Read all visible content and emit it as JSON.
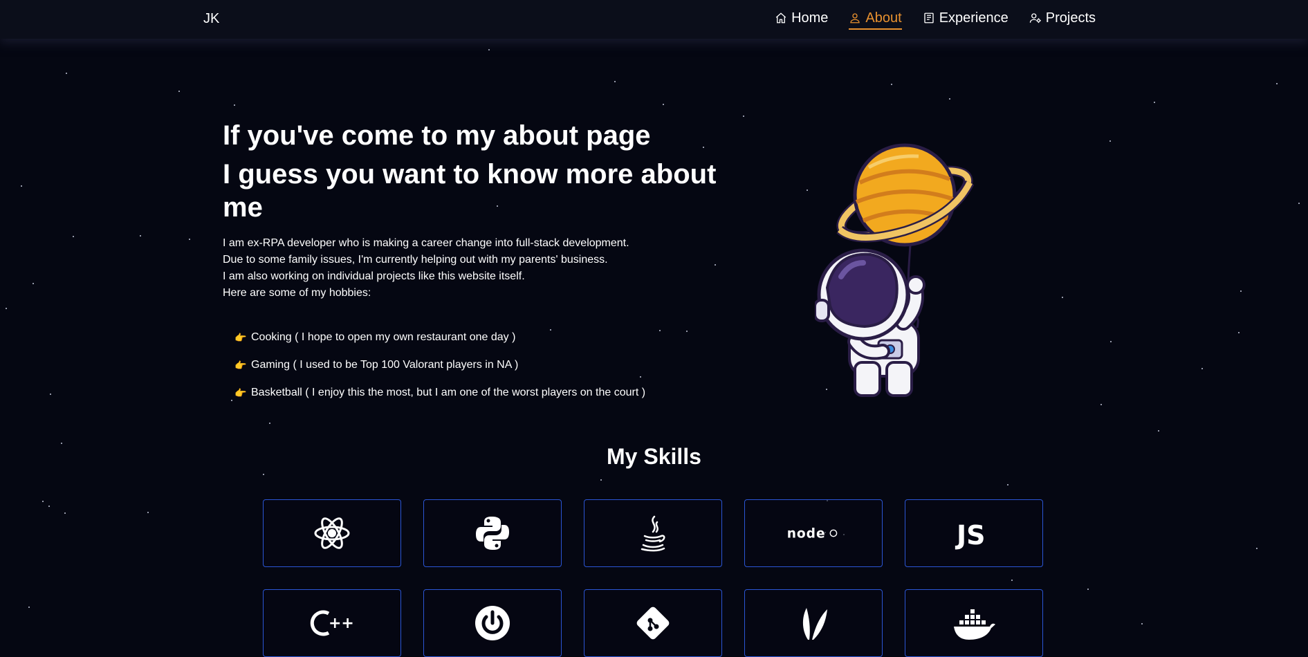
{
  "nav": {
    "brand": "JK",
    "items": [
      {
        "label": "Home",
        "icon": "home-icon"
      },
      {
        "label": "About",
        "icon": "user-icon",
        "active": true
      },
      {
        "label": "Experience",
        "icon": "document-icon"
      },
      {
        "label": "Projects",
        "icon": "user-gear-icon"
      }
    ]
  },
  "hero": {
    "title_line1": "If you've come to my about page",
    "title_line2": "I guess you want to know more about me",
    "paragraph": [
      "I am ex-RPA developer who is making a career change into full-stack development.",
      "Due to some family issues, I'm currently helping out with my parents' business.",
      "I am also working on individual projects like this website itself.",
      "Here are some of my hobbies:"
    ],
    "hobby_emoji": "👉",
    "hobbies": [
      "Cooking ( I hope to open my own restaurant one day )",
      "Gaming ( I used to be Top 100 Valorant players in NA )",
      "Basketball ( I enjoy this the most, but I am one of the worst players on the court )"
    ],
    "illustration": "astronaut-with-planet-balloon"
  },
  "skills": {
    "title": "My Skills",
    "items": [
      {
        "name": "react-icon"
      },
      {
        "name": "python-icon"
      },
      {
        "name": "java-icon"
      },
      {
        "name": "nodejs-icon",
        "text": "node"
      },
      {
        "name": "javascript-icon",
        "text": "JS"
      },
      {
        "name": "cplusplus-icon",
        "text": "++"
      },
      {
        "name": "spring-icon"
      },
      {
        "name": "git-icon"
      },
      {
        "name": "apache-feather-icon"
      },
      {
        "name": "docker-icon"
      }
    ]
  },
  "colors": {
    "background": "#050712",
    "navbar": "#0b0e1a",
    "accent": "#e8912f",
    "card_border": "#2b56d6"
  }
}
